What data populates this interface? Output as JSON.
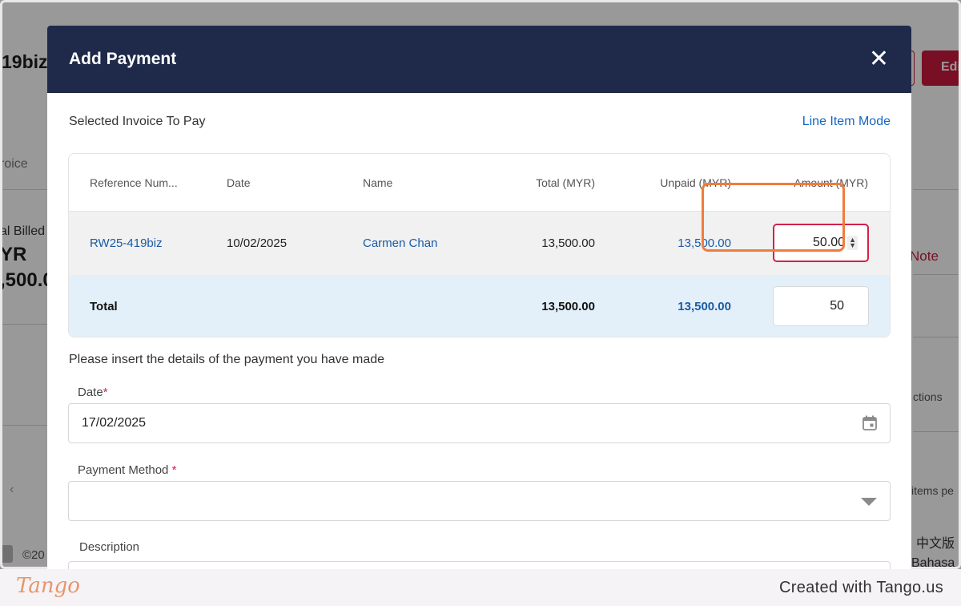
{
  "background": {
    "title_fragment": "19biz",
    "tab_fragment": "roice",
    "billed_label": "al Billed",
    "billed_currency": "YR",
    "billed_value": ",500.0",
    "edit_fragment": "Edi",
    "note_fragment": "Note",
    "actions_fragment": "ctions",
    "items_fragment": "items pe",
    "copyright_fragment": "©20",
    "lang_chinese": "中文版",
    "lang_bahasa": "Bahasa N",
    "chevron": "‹"
  },
  "modal": {
    "title": "Add Payment",
    "close_glyph": "✕",
    "selected_invoice_label": "Selected Invoice To Pay",
    "line_item_mode_label": "Line Item Mode",
    "table": {
      "headers": [
        "Reference Num...",
        "Date",
        "Name",
        "Total (MYR)",
        "Unpaid (MYR)",
        "Amount (MYR)"
      ],
      "row": {
        "reference": "RW25-419biz",
        "date": "10/02/2025",
        "name": "Carmen Chan",
        "total": "13,500.00",
        "unpaid": "13,500.00",
        "amount": "50.00"
      },
      "total_row": {
        "label": "Total",
        "total": "13,500.00",
        "unpaid": "13,500.00",
        "amount": "50"
      }
    },
    "instructions": "Please insert the details of the payment you have made",
    "date_field": {
      "label": "Date",
      "required_mark": "*",
      "value": "17/02/2025"
    },
    "payment_method_field": {
      "label": "Payment Method",
      "required_mark": "*",
      "value": ""
    },
    "description_field": {
      "label": "Description"
    }
  },
  "footer": {
    "logo_text": "Tango",
    "created_with": "Created with Tango.us"
  },
  "colors": {
    "modal_header": "#1f2a4a",
    "link": "#1a5aa6",
    "accent_red": "#d4204a",
    "highlight_orange": "#f07c3c",
    "total_row_bg": "#e3f0f9"
  }
}
